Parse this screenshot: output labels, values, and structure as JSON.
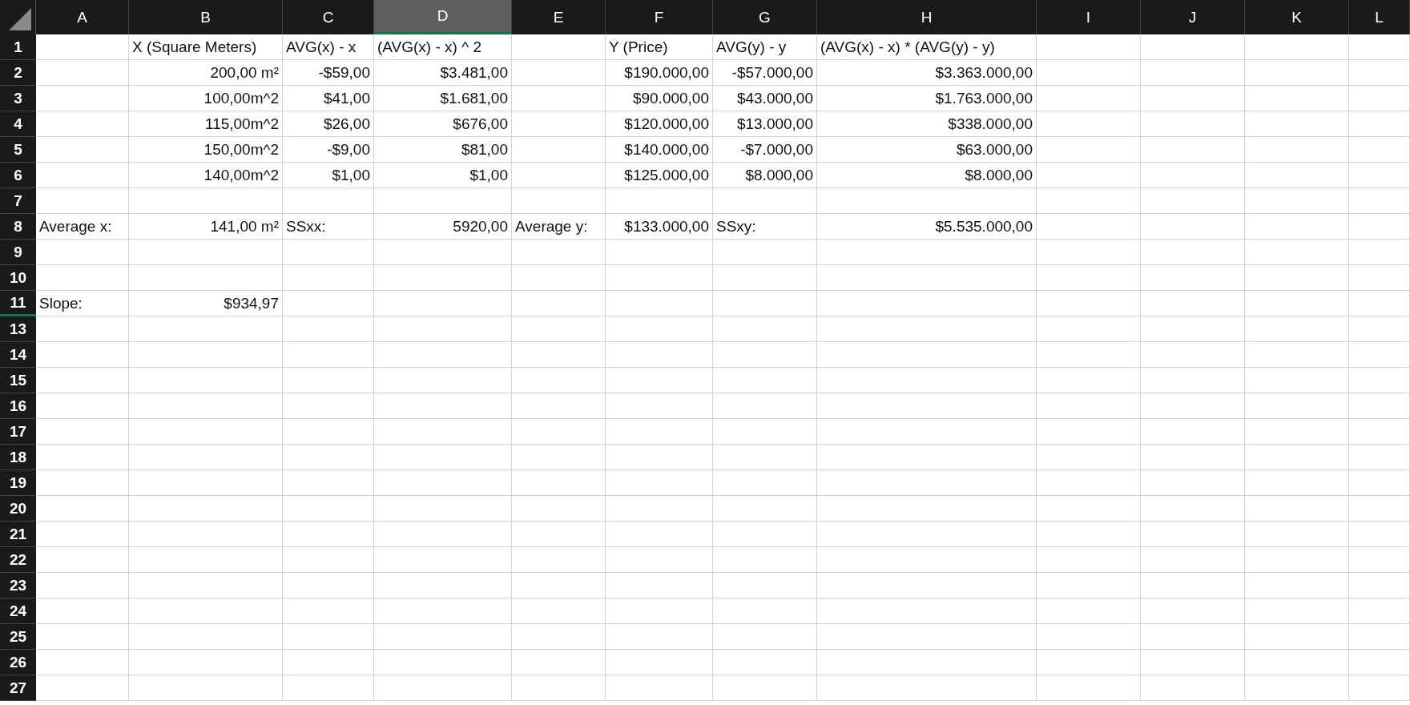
{
  "sheet": {
    "columns": [
      {
        "letter": "A",
        "selected": false
      },
      {
        "letter": "B",
        "selected": false
      },
      {
        "letter": "C",
        "selected": false
      },
      {
        "letter": "D",
        "selected": true
      },
      {
        "letter": "E",
        "selected": false
      },
      {
        "letter": "F",
        "selected": false
      },
      {
        "letter": "G",
        "selected": false
      },
      {
        "letter": "H",
        "selected": false
      },
      {
        "letter": "I",
        "selected": false
      },
      {
        "letter": "J",
        "selected": false
      },
      {
        "letter": "K",
        "selected": false
      },
      {
        "letter": "L",
        "selected": false
      }
    ],
    "rows": [
      {
        "number": "1",
        "highlighted": false,
        "cells": {
          "B": {
            "text": "X (Square Meters)",
            "kind": "text"
          },
          "C": {
            "text": "AVG(x) - x",
            "kind": "text"
          },
          "D": {
            "text": "(AVG(x) - x)  ^ 2",
            "kind": "text"
          },
          "F": {
            "text": "Y (Price)",
            "kind": "text"
          },
          "G": {
            "text": "AVG(y) - y",
            "kind": "text"
          },
          "H": {
            "text": "(AVG(x) - x) * (AVG(y) - y)",
            "kind": "text"
          }
        }
      },
      {
        "number": "2",
        "highlighted": false,
        "cells": {
          "B": {
            "text": "200,00 m²",
            "kind": "number"
          },
          "C": {
            "text": "-$59,00",
            "kind": "number"
          },
          "D": {
            "text": "$3.481,00",
            "kind": "number"
          },
          "F": {
            "text": "$190.000,00",
            "kind": "number"
          },
          "G": {
            "text": "-$57.000,00",
            "kind": "number"
          },
          "H": {
            "text": "$3.363.000,00",
            "kind": "number"
          }
        }
      },
      {
        "number": "3",
        "highlighted": false,
        "cells": {
          "B": {
            "text": "100,00m^2",
            "kind": "number"
          },
          "C": {
            "text": "$41,00",
            "kind": "number"
          },
          "D": {
            "text": "$1.681,00",
            "kind": "number"
          },
          "F": {
            "text": "$90.000,00",
            "kind": "number"
          },
          "G": {
            "text": "$43.000,00",
            "kind": "number"
          },
          "H": {
            "text": "$1.763.000,00",
            "kind": "number"
          }
        }
      },
      {
        "number": "4",
        "highlighted": false,
        "cells": {
          "B": {
            "text": "115,00m^2",
            "kind": "number"
          },
          "C": {
            "text": "$26,00",
            "kind": "number"
          },
          "D": {
            "text": "$676,00",
            "kind": "number"
          },
          "F": {
            "text": "$120.000,00",
            "kind": "number"
          },
          "G": {
            "text": "$13.000,00",
            "kind": "number"
          },
          "H": {
            "text": "$338.000,00",
            "kind": "number"
          }
        }
      },
      {
        "number": "5",
        "highlighted": false,
        "cells": {
          "B": {
            "text": "150,00m^2",
            "kind": "number"
          },
          "C": {
            "text": "-$9,00",
            "kind": "number"
          },
          "D": {
            "text": "$81,00",
            "kind": "number"
          },
          "F": {
            "text": "$140.000,00",
            "kind": "number"
          },
          "G": {
            "text": "-$7.000,00",
            "kind": "number"
          },
          "H": {
            "text": "$63.000,00",
            "kind": "number"
          }
        }
      },
      {
        "number": "6",
        "highlighted": false,
        "cells": {
          "B": {
            "text": "140,00m^2",
            "kind": "number"
          },
          "C": {
            "text": "$1,00",
            "kind": "number"
          },
          "D": {
            "text": "$1,00",
            "kind": "number"
          },
          "F": {
            "text": "$125.000,00",
            "kind": "number"
          },
          "G": {
            "text": "$8.000,00",
            "kind": "number"
          },
          "H": {
            "text": "$8.000,00",
            "kind": "number"
          }
        }
      },
      {
        "number": "7",
        "highlighted": false
      },
      {
        "number": "8",
        "highlighted": false,
        "cells": {
          "A": {
            "text": "Average x:",
            "kind": "text"
          },
          "B": {
            "text": "141,00 m²",
            "kind": "number"
          },
          "C": {
            "text": "SSxx:",
            "kind": "text"
          },
          "D": {
            "text": "5920,00",
            "kind": "number"
          },
          "E": {
            "text": "Average y:",
            "kind": "text"
          },
          "F": {
            "text": "$133.000,00",
            "kind": "number"
          },
          "G": {
            "text": "SSxy:",
            "kind": "text"
          },
          "H": {
            "text": "$5.535.000,00",
            "kind": "number"
          }
        }
      },
      {
        "number": "9",
        "highlighted": false
      },
      {
        "number": "10",
        "highlighted": false
      },
      {
        "number": "11",
        "highlighted": true,
        "cells": {
          "A": {
            "text": "Slope:",
            "kind": "text"
          },
          "B": {
            "text": "$934,97",
            "kind": "number"
          }
        }
      },
      {
        "number": "13",
        "highlighted": false
      },
      {
        "number": "14",
        "highlighted": false
      },
      {
        "number": "15",
        "highlighted": false
      },
      {
        "number": "16",
        "highlighted": false
      },
      {
        "number": "17",
        "highlighted": false
      },
      {
        "number": "18",
        "highlighted": false
      },
      {
        "number": "19",
        "highlighted": false
      },
      {
        "number": "20",
        "highlighted": false
      },
      {
        "number": "21",
        "highlighted": false
      },
      {
        "number": "22",
        "highlighted": false
      },
      {
        "number": "23",
        "highlighted": false
      },
      {
        "number": "24",
        "highlighted": false
      },
      {
        "number": "25",
        "highlighted": false
      },
      {
        "number": "26",
        "highlighted": false
      },
      {
        "number": "27",
        "highlighted": false
      }
    ]
  }
}
